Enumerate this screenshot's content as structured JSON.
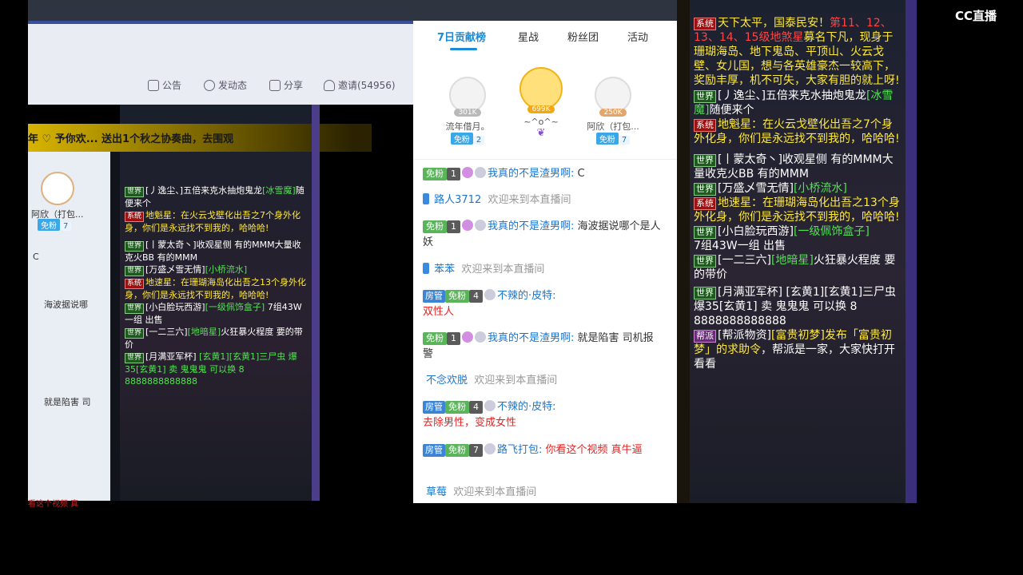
{
  "left": {
    "actions": [
      {
        "label": "公告",
        "icon": "notice-icon"
      },
      {
        "label": "发动态",
        "icon": "post-icon"
      },
      {
        "label": "分享",
        "icon": "share-icon"
      },
      {
        "label": "邀请(54956)",
        "icon": "invite-icon"
      }
    ],
    "banner_text": "年 ♡ 予你欢... 送出1个秋之协奏曲，去围观",
    "side": {
      "name": "阿欣（打包...",
      "fan": "免粉",
      "lvl": "7",
      "c_label": "C",
      "text1": "海波据说哪",
      "text2": "就是陷害 司"
    },
    "bottom_text": "看这个视频 真"
  },
  "middle": {
    "tabs": [
      "7日贡献榜",
      "星战",
      "粉丝团",
      "活动"
    ],
    "ranks": [
      {
        "name": "流年借月。",
        "pts": "301K",
        "fan": "免粉",
        "lvl": "2"
      },
      {
        "name": "~^o^~",
        "pts": "699K",
        "fan": "",
        "lvl": ""
      },
      {
        "name": "阿欣（打包...",
        "pts": "250K",
        "fan": "免粉",
        "lvl": "7"
      }
    ],
    "messages": [
      {
        "fan": "免粉",
        "lv": "1",
        "user": "我真的不是渣男啊:",
        "text": "C"
      },
      {
        "user": "路人3712",
        "text": "欢迎来到本直播间"
      },
      {
        "fan": "免粉",
        "lv": "1",
        "user": "我真的不是渣男啊:",
        "text": "海波据说哪个是人妖"
      },
      {
        "user": "苯苯",
        "text": "欢迎来到本直播间"
      },
      {
        "mgr": "房管",
        "fan": "免粉",
        "lv": "4",
        "user": "不辣的·皮特:",
        "text": "双性人"
      },
      {
        "fan": "免粉",
        "lv": "1",
        "user": "我真的不是渣男啊:",
        "text": "就是陷害 司机报警"
      },
      {
        "user": "不念欢脱",
        "text": "欢迎来到本直播间"
      },
      {
        "mgr": "房管",
        "fan": "免粉",
        "lv": "4",
        "user": "不辣的·皮特:",
        "text": "去除男性，变成女性"
      },
      {
        "mgr": "房管",
        "fan": "免粉",
        "lv": "7",
        "user": "路飞打包:",
        "text": "你看这个视频 真牛逼"
      },
      {
        "user": "草莓",
        "text": "欢迎来到本直播间"
      }
    ]
  },
  "game_chat": {
    "lines": [
      {
        "tag": "系统",
        "a": "天下太平，国泰民安！",
        "b": "第11、12、13、14、15级地煞星",
        "c": "募名下凡，现身于珊瑚海岛、地下鬼岛、平顶山、火云戈壁、女儿国，想与各英雄豪杰一较高下，奖励丰厚，机不可失，大家有胆的就上呀!"
      },
      {
        "tag": "世界",
        "a": "[丿逸尘、]五倍来克水抽炮鬼龙",
        "b": "[冰雪魔]",
        "c": "随便来个"
      },
      {
        "tag": "系统",
        "a": "地魁星",
        "b": "：在火云戈壁化出吾之7个身外化身，你们是永远找不到我的，哈哈哈!",
        "c": ""
      },
      {
        "tag": "世界",
        "a": "[丨蒙太奇丶]收观星侧",
        "b": "",
        "c": "有的MMM大量收克火BB     有的MMM"
      },
      {
        "tag": "世界",
        "a": "[万盛乄雪无情]",
        "b": "[小桥流水]",
        "c": ""
      },
      {
        "tag": "系统",
        "a": "地速星",
        "b": "：在珊瑚海岛化出吾之13个身外化身，你们是永远找不到我的，哈哈哈!",
        "c": ""
      },
      {
        "tag": "世界",
        "a": "[小白脸玩西游]",
        "b": "[一级佩饰盒子]",
        "c": "7组43W一组  出售"
      },
      {
        "tag": "世界",
        "a": "[一二三六]",
        "b": "[地暗星]",
        "c": "火狂暴火程度 要的带价"
      },
      {
        "tag": "世界",
        "a": "[月满亚军杯]",
        "b": "",
        "c": "[玄黄1][玄黄1]三尸虫 爆35[玄黄1] 卖 鬼鬼鬼 可以换 8 8888888888888"
      },
      {
        "tag": "帮派",
        "a": "[帮派物资]",
        "b": "[富贵初梦]发布「富贵初梦」的求助令",
        "c": "，帮派是一家，大家快打开看看"
      }
    ]
  },
  "logo": "CC直播"
}
